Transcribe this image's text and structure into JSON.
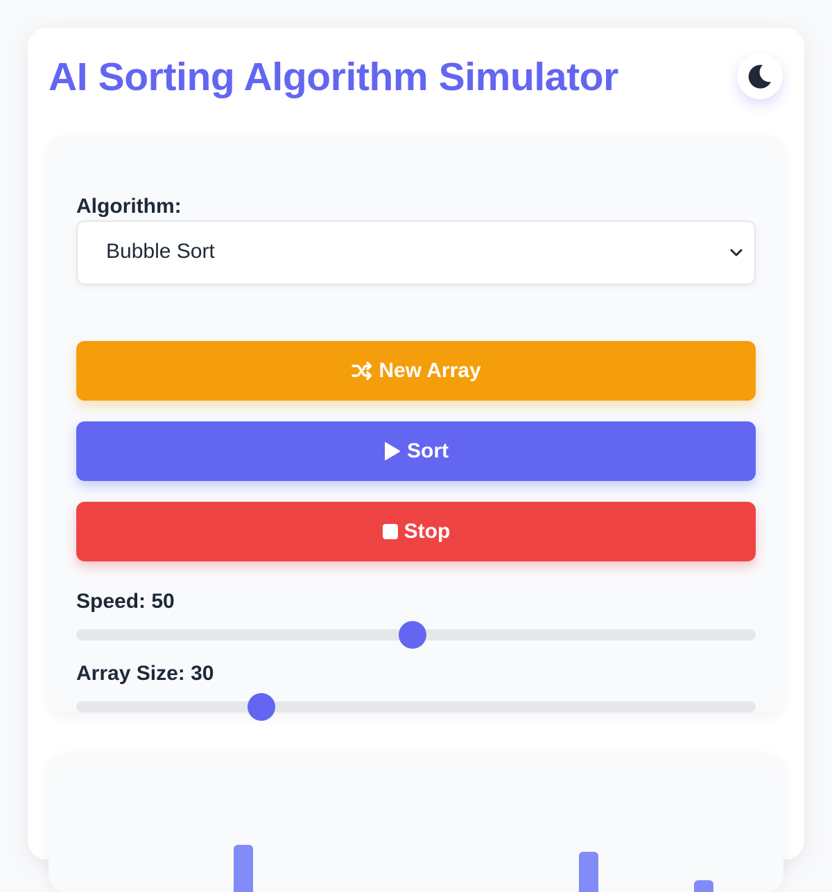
{
  "app": {
    "title": "AI Sorting Algorithm Simulator",
    "theme_toggle_icon": "moon-icon"
  },
  "controls": {
    "algorithm_label": "Algorithm:",
    "algorithm_selected": "Bubble Sort",
    "buttons": {
      "new_array": {
        "label": "New Array",
        "icon": "shuffle-icon",
        "color": "#f59e0b"
      },
      "sort": {
        "label": "Sort",
        "icon": "play-icon",
        "color": "#6366f1"
      },
      "stop": {
        "label": "Stop",
        "icon": "stop-icon",
        "color": "#ef4444"
      }
    },
    "speed": {
      "label": "Speed: 50",
      "value": 50,
      "min": 1,
      "max": 100
    },
    "array_size": {
      "label": "Array Size: 30",
      "value": 30,
      "min": 5,
      "max": 100
    }
  },
  "colors": {
    "accent": "#6366f1",
    "bar": "#818cf8",
    "background": "#f8f9fb"
  },
  "visualization": {
    "bars": [
      {
        "index": 7,
        "relative_height": 0.97
      },
      {
        "index": 22,
        "relative_height": 0.83
      },
      {
        "index": 27,
        "relative_height": 0.25
      }
    ]
  }
}
